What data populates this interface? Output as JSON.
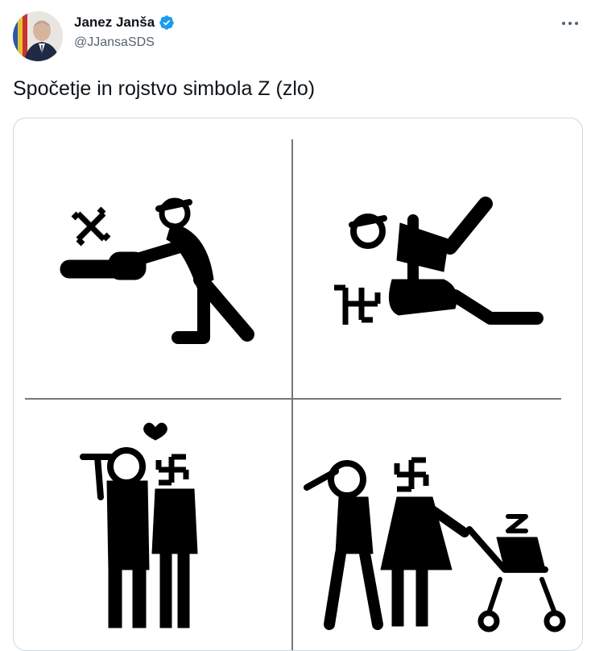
{
  "author": {
    "display_name": "Janez Janša",
    "handle": "@JJansaSDS",
    "verified": true
  },
  "tweet": {
    "text": "Spočetje in rojstvo simbola Z (zlo)"
  },
  "icons": {
    "more": "more-horizontal-icon",
    "verified": "verified-badge-icon"
  },
  "colors": {
    "verified_blue": "#1d9bf0",
    "secondary_text": "#536471",
    "border": "#cfd9de"
  }
}
